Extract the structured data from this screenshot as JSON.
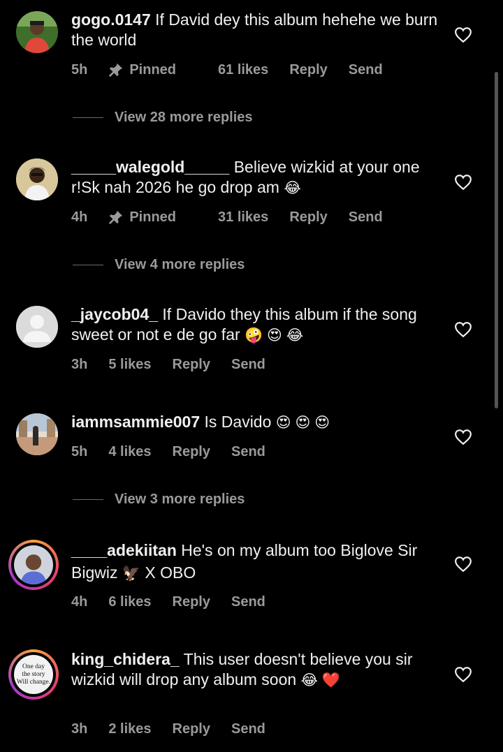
{
  "comments": [
    {
      "username": "gogo.0147",
      "text": " If David dey this album hehehe we burn the world",
      "emoji": "",
      "time": "5h",
      "pinned_label": "Pinned",
      "likes": "61 likes",
      "reply": "Reply",
      "send": "Send",
      "view_more": "View 28 more replies"
    },
    {
      "username": "_____walegold_____",
      "text": " Believe wizkid at your one r!Sk nah 2026 he go drop am ",
      "emoji": "😂",
      "time": "4h",
      "pinned_label": "Pinned",
      "likes": "31 likes",
      "reply": "Reply",
      "send": "Send",
      "view_more": "View 4 more replies"
    },
    {
      "username": "_jaycob04_",
      "text": " If Davido they this album if the song sweet or not  e de go far ",
      "emoji": "🤪 😍 😂",
      "time": "3h",
      "likes": "5 likes",
      "reply": "Reply",
      "send": "Send"
    },
    {
      "username": "iammsammie007",
      "text": " Is Davido ",
      "emoji": "😍 😍 😍",
      "time": "5h",
      "likes": "4 likes",
      "reply": "Reply",
      "send": "Send",
      "view_more": "View 3 more replies"
    },
    {
      "username": "____adekiitan",
      "text": " He's on my album too Biglove Sir Bigwiz ",
      "emoji": "🦅",
      "text_after": " X OBO",
      "time": "4h",
      "likes": "6 likes",
      "reply": "Reply",
      "send": "Send"
    },
    {
      "username": "king_chidera_",
      "text": " This user doesn't believe you sir wizkid will drop any album soon ",
      "emoji": "😂 ❤️",
      "time": "3h",
      "likes": "2 likes",
      "reply": "Reply",
      "send": "Send",
      "avatar_text": [
        "One day",
        "the story",
        "Will change."
      ]
    }
  ],
  "colors": {
    "background": "#000000",
    "text": "#f0f0f0",
    "muted": "#9a9a9a",
    "story_ring": [
      "#f9a13b",
      "#e83c6d",
      "#a23ac9"
    ]
  },
  "icons": {
    "like": "heart-outline-icon",
    "pin": "pin-icon"
  }
}
